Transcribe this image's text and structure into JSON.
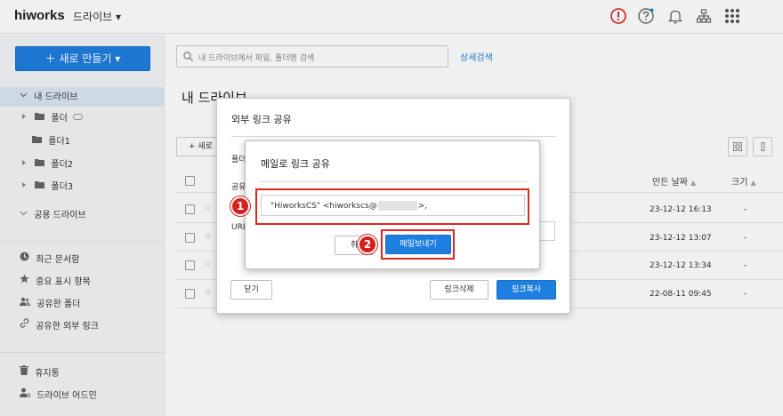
{
  "header": {
    "logo": "hiworks",
    "app_name": "드라이브 ▾",
    "icons": [
      "alert-icon",
      "help-icon",
      "bell-icon",
      "org-chart-icon",
      "apps-grid-icon"
    ],
    "alert_color": "#d6201a",
    "accent_color": "#1f7fe0"
  },
  "sidebar": {
    "new_button": "＋ 새로 만들기 ▾",
    "my_drive": "내 드라이브",
    "folders": [
      "폴더",
      "폴더1",
      "폴더2",
      "폴더3"
    ],
    "shared_drive": "공용 드라이브",
    "items": [
      "최근 문서함",
      "중요 표시 항목",
      "공유한 폴더",
      "공유한 외부 링크"
    ],
    "trash": "휴지통",
    "admin": "드라이브 어드민"
  },
  "main": {
    "search_placeholder": "내 드라이브에서 파일, 폴더명 검색",
    "advanced_search": "상세검색",
    "title": "내 드라이브",
    "new_button": "+ 새로",
    "columns": {
      "modified": "만든 날짜",
      "size": "크기"
    },
    "rows": [
      {
        "date": "23-12-12 16:13",
        "size": "-"
      },
      {
        "date": "23-12-12 13:07",
        "size": "-"
      },
      {
        "date": "23-12-12 13:34",
        "size": "-"
      },
      {
        "date": "22-08-11 09:45",
        "size": "-"
      }
    ]
  },
  "outer_dialog": {
    "title": "외부 링크 공유",
    "label_folder": "폴더",
    "label_share": "공유",
    "label_url": "URL",
    "close_button": "닫기",
    "delete_link_button": "링크삭제",
    "copy_link_button": "링크복사"
  },
  "inner_dialog": {
    "title": "메일로 링크 공유",
    "recipient_prefix": "\"HiworksCS\" <hiworkscs@",
    "recipient_suffix": ">,",
    "cancel_fragment": "취",
    "send_button": "메일보내기",
    "step1": "1",
    "step2": "2"
  }
}
